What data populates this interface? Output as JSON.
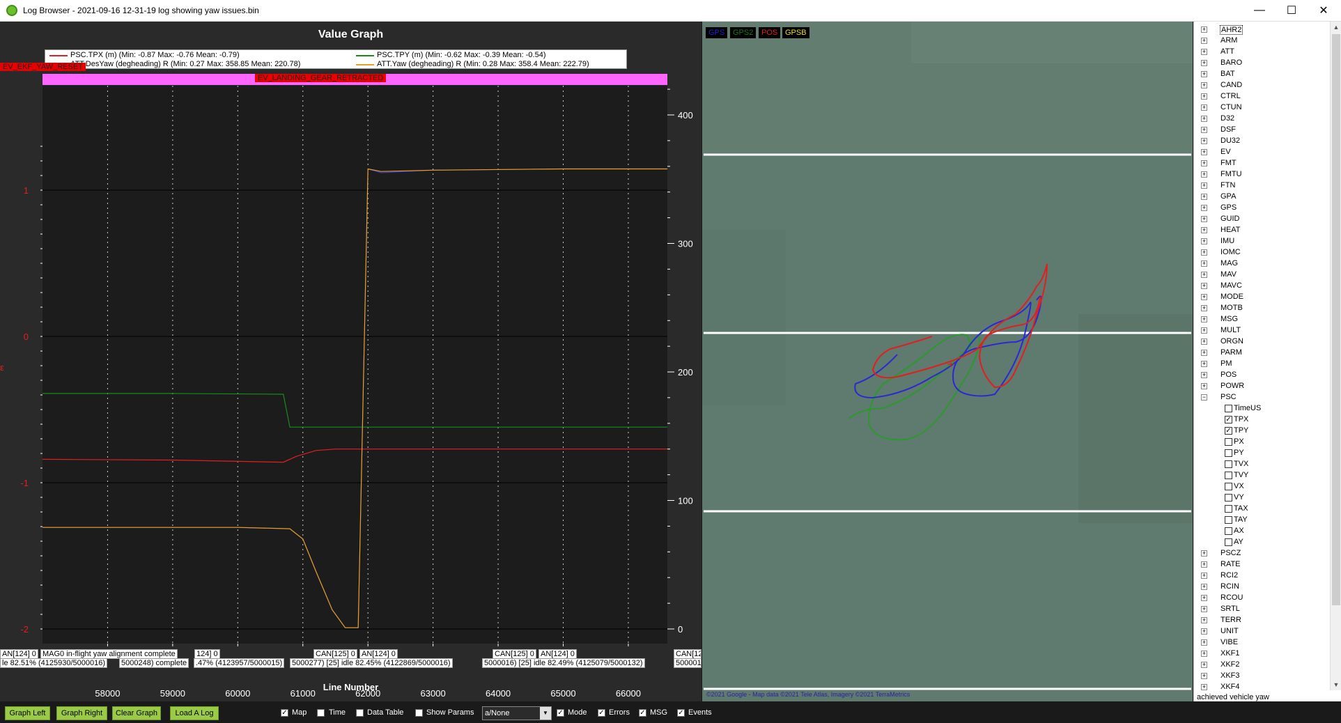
{
  "window": {
    "title": "Log Browser - 2021-09-16 12-31-19 log showing yaw issues.bin",
    "minimize": "—",
    "maximize": "☐",
    "close": "✕"
  },
  "graph": {
    "title": "Value Graph",
    "xlabel": "Line Number",
    "legend": [
      {
        "label": "PSC.TPX (m) (Min: -0.87 Max: -0.76 Mean: -0.79)",
        "color": "#e02020"
      },
      {
        "label": "PSC.TPY (m) (Min: -0.62 Max: -0.39 Mean: -0.54)",
        "color": "#1a8c1a"
      },
      {
        "label": "ATT.DesYaw (degheading) R (Min: 0.27 Max: 358.85 Mean: 220.78)",
        "color": "#3333cc"
      },
      {
        "label": "ATT.Yaw (degheading) R (Min: 0.28 Max: 358.4 Mean: 222.79)",
        "color": "#e8a020"
      }
    ],
    "events": {
      "ekf_yaw_reset": "EV_EKF_YAW_RESET",
      "landing_gear": "EV_LANDING_GEAR_RETRACTED"
    },
    "messages_row1": [
      "AN[124] 0",
      "MAG0 in-flight yaw alignment complete",
      "124] 0",
      "CAN[125] 0",
      "AN[124] 0",
      "CAN[125] 0",
      "AN[124] 0",
      "CAN[12"
    ],
    "messages_row2": [
      "le 82.51% (4125930/5000016)",
      "5000248) complete",
      ".47% (4123957/5000015)",
      "5000277) [25] idle 82.45% (4122869/5000016)",
      "5000016) [25] idle 82.49% (4125079/5000132)",
      "5000016) [25"
    ],
    "left_marker": "ε",
    "chart_data": {
      "type": "line",
      "xlim": [
        57000,
        66600
      ],
      "x_ticks": [
        58000,
        59000,
        60000,
        61000,
        62000,
        63000,
        64000,
        65000,
        66000
      ],
      "y_left_ticks": [
        1,
        0,
        -1,
        -2
      ],
      "y_right_ticks": [
        400,
        300,
        200,
        100,
        0
      ],
      "y_left_range": [
        -2,
        1
      ],
      "y_right_range": [
        0,
        400
      ],
      "series": [
        {
          "name": "PSC.TPX (m)",
          "axis": "left",
          "color": "#e02020",
          "x": [
            57000,
            59000,
            60700,
            60900,
            61200,
            61500,
            66600
          ],
          "y": [
            -0.84,
            -0.845,
            -0.86,
            -0.82,
            -0.78,
            -0.77,
            -0.77
          ]
        },
        {
          "name": "PSC.TPY (m)",
          "axis": "left",
          "color": "#1a8c1a",
          "x": [
            57000,
            59000,
            60700,
            60800,
            66600
          ],
          "y": [
            -0.39,
            -0.39,
            -0.395,
            -0.62,
            -0.62
          ]
        },
        {
          "name": "ATT.DesYaw (degheading)",
          "axis": "right",
          "color": "#3333cc",
          "x": [
            57000,
            60000,
            60800,
            61000,
            61200,
            61450,
            61650,
            61850,
            62000,
            62200,
            63000,
            65000,
            66600
          ],
          "y": [
            79,
            79,
            78,
            70,
            45,
            15,
            1,
            1,
            358,
            355,
            357,
            358,
            358
          ]
        },
        {
          "name": "ATT.Yaw (degheading)",
          "axis": "right",
          "color": "#e8a020",
          "x": [
            57000,
            60000,
            60800,
            61000,
            61200,
            61450,
            61650,
            61850,
            62000,
            62200,
            63000,
            65000,
            66600
          ],
          "y": [
            79,
            79,
            78,
            70,
            45,
            15,
            1,
            1,
            358,
            356,
            357,
            358,
            358
          ]
        }
      ]
    }
  },
  "map": {
    "legend": [
      {
        "label": "GPS",
        "color": "#2222cc"
      },
      {
        "label": "GPS2",
        "color": "#1a7a1a"
      },
      {
        "label": "POS",
        "color": "#e02020"
      },
      {
        "label": "GPSB",
        "color": "#e8e020"
      }
    ],
    "credit": "©2021 Google - Map data ©2021 Tele Atlas, Imagery ©2021 TerraMetrics"
  },
  "tree": {
    "items": [
      {
        "label": "AHR2",
        "selected": true
      },
      {
        "label": "ARM"
      },
      {
        "label": "ATT"
      },
      {
        "label": "BARO"
      },
      {
        "label": "BAT"
      },
      {
        "label": "CAND"
      },
      {
        "label": "CTRL"
      },
      {
        "label": "CTUN"
      },
      {
        "label": "D32"
      },
      {
        "label": "DSF"
      },
      {
        "label": "DU32"
      },
      {
        "label": "EV"
      },
      {
        "label": "FMT"
      },
      {
        "label": "FMTU"
      },
      {
        "label": "FTN"
      },
      {
        "label": "GPA"
      },
      {
        "label": "GPS"
      },
      {
        "label": "GUID"
      },
      {
        "label": "HEAT"
      },
      {
        "label": "IMU"
      },
      {
        "label": "IOMC"
      },
      {
        "label": "MAG"
      },
      {
        "label": "MAV"
      },
      {
        "label": "MAVC"
      },
      {
        "label": "MODE"
      },
      {
        "label": "MOTB"
      },
      {
        "label": "MSG"
      },
      {
        "label": "MULT"
      },
      {
        "label": "ORGN"
      },
      {
        "label": "PARM"
      },
      {
        "label": "PM"
      },
      {
        "label": "POS"
      },
      {
        "label": "POWR"
      },
      {
        "label": "PSC",
        "expanded": true
      }
    ],
    "psc_children": [
      {
        "label": "TimeUS",
        "checked": false
      },
      {
        "label": "TPX",
        "checked": true
      },
      {
        "label": "TPY",
        "checked": true
      },
      {
        "label": "PX",
        "checked": false
      },
      {
        "label": "PY",
        "checked": false
      },
      {
        "label": "TVX",
        "checked": false
      },
      {
        "label": "TVY",
        "checked": false
      },
      {
        "label": "VX",
        "checked": false
      },
      {
        "label": "VY",
        "checked": false
      },
      {
        "label": "TAX",
        "checked": false
      },
      {
        "label": "TAY",
        "checked": false
      },
      {
        "label": "AX",
        "checked": false
      },
      {
        "label": "AY",
        "checked": false
      }
    ],
    "items_after": [
      {
        "label": "PSCZ"
      },
      {
        "label": "RATE"
      },
      {
        "label": "RCI2"
      },
      {
        "label": "RCIN"
      },
      {
        "label": "RCOU"
      },
      {
        "label": "SRTL"
      },
      {
        "label": "TERR"
      },
      {
        "label": "UNIT"
      },
      {
        "label": "VIBE"
      },
      {
        "label": "XKF1"
      },
      {
        "label": "XKF2"
      },
      {
        "label": "XKF3"
      },
      {
        "label": "XKF4"
      }
    ],
    "status": "achieved vehicle yaw"
  },
  "toolbar": {
    "graph_left": "Graph Left",
    "graph_right": "Graph Right",
    "clear_graph": "Clear Graph",
    "load_log": "Load A Log",
    "map": "Map",
    "time": "Time",
    "data_table": "Data Table",
    "show_params": "Show Params",
    "combo_value": "a/None",
    "mode": "Mode",
    "errors": "Errors",
    "msg": "MSG",
    "events": "Events"
  },
  "checks": {
    "map": true,
    "time": false,
    "data_table": false,
    "show_params": false,
    "mode": true,
    "errors": true,
    "msg": true,
    "events": true
  }
}
